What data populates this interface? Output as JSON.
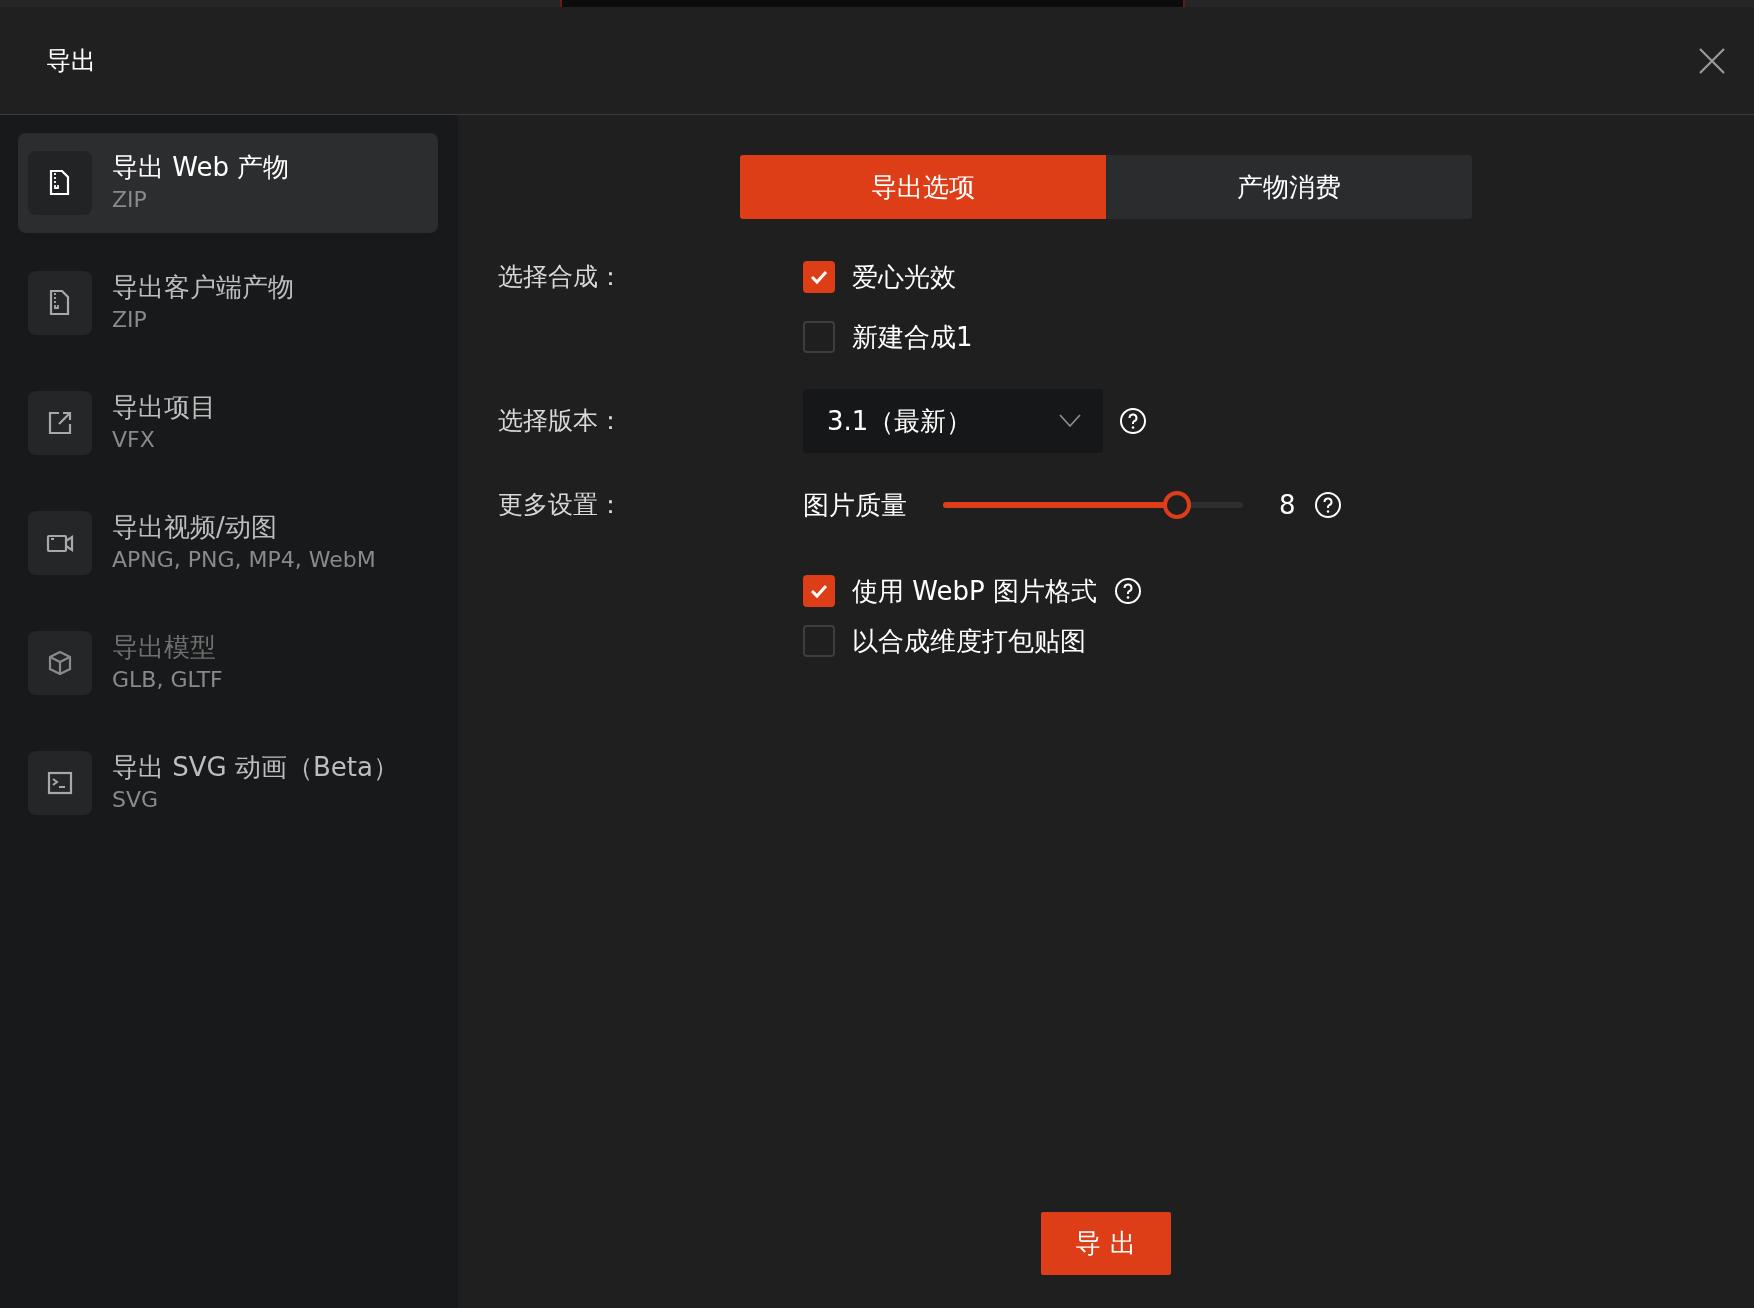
{
  "dialog": {
    "title": "导出"
  },
  "sidebar": {
    "items": [
      {
        "title": "导出 Web 产物",
        "subtitle": "ZIP",
        "selected": true,
        "disabled": false
      },
      {
        "title": "导出客户端产物",
        "subtitle": "ZIP",
        "selected": false,
        "disabled": false
      },
      {
        "title": "导出项目",
        "subtitle": "VFX",
        "selected": false,
        "disabled": false
      },
      {
        "title": "导出视频/动图",
        "subtitle": "APNG, PNG, MP4, WebM",
        "selected": false,
        "disabled": false
      },
      {
        "title": "导出模型",
        "subtitle": "GLB, GLTF",
        "selected": false,
        "disabled": true
      },
      {
        "title": "导出 SVG 动画（Beta）",
        "subtitle": "SVG",
        "selected": false,
        "disabled": false
      }
    ]
  },
  "tabs": [
    {
      "label": "导出选项",
      "selected": true
    },
    {
      "label": "产物消费",
      "selected": false
    }
  ],
  "form": [
    {
      "kind": "checkboxes",
      "label": "选择合成：",
      "options": [
        {
          "label": "爱心光效",
          "checked": true
        },
        {
          "label": "新建合成1",
          "checked": false
        }
      ]
    },
    {
      "kind": "select",
      "label": "选择版本：",
      "value": "3.1（最新）",
      "help": true
    },
    {
      "kind": "settings",
      "label": "更多设置：",
      "slider": {
        "label": "图片质量",
        "level": 0.78,
        "reading": "8",
        "help": true
      },
      "options": [
        {
          "label": "使用 WebP 图片格式",
          "checked": true,
          "help": true
        },
        {
          "label": "以合成维度打包贴图",
          "checked": false,
          "help": false
        }
      ]
    }
  ],
  "export_button": "导 出"
}
